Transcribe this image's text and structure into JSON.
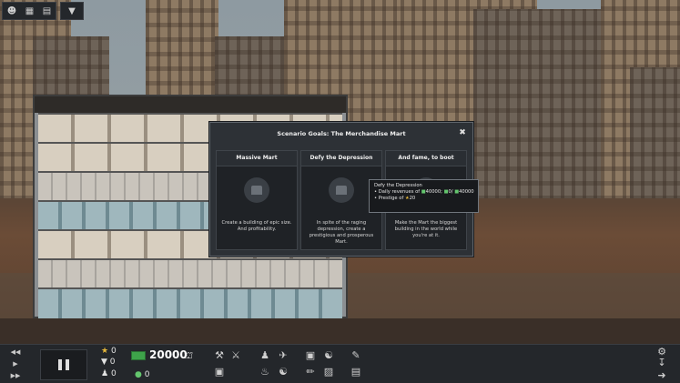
{
  "top_buttons": {
    "icons": [
      "people-icon",
      "map-icon",
      "book-icon"
    ],
    "dropdown_icon": "triangle-down-icon"
  },
  "modal": {
    "title": "Scenario Goals: The Merchandise Mart",
    "close_glyph": "✖",
    "goals": [
      {
        "title": "Massive Mart",
        "description": "Create a building of epic size. And profitability."
      },
      {
        "title": "Defy the Depression",
        "description": "In spite of the raging depression, create a prestigious and prosperous Mart."
      },
      {
        "title": "And fame, to boot",
        "description": "Make the Mart the biggest building in the world while you're at it."
      }
    ]
  },
  "tooltip": {
    "title": "Defy the Depression",
    "revenues_label": "Daily revenues of",
    "revenue_a": "40000",
    "revenue_b": "0",
    "revenue_c": "40000",
    "prestige_label": "Prestige of",
    "prestige_value": "20"
  },
  "toolbar": {
    "star_count": "0",
    "prestige_count": "0",
    "money": "20000",
    "left_count": "0",
    "unknown_count": "0"
  },
  "colors": {
    "money_green": "#3ea34a",
    "star_gold": "#e5b73b",
    "panel_bg": "#2d3136"
  }
}
